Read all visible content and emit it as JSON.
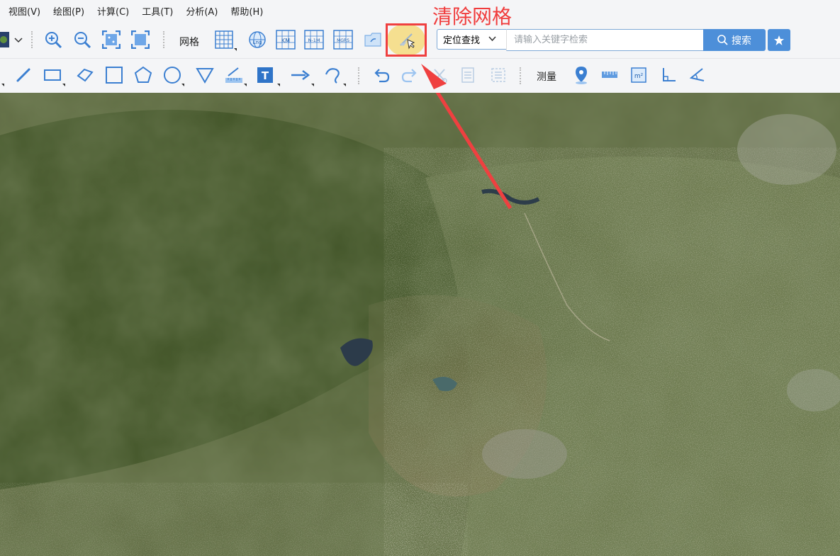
{
  "menu": {
    "items": [
      "视图(V)",
      "绘图(P)",
      "计算(C)",
      "工具(T)",
      "分析(A)",
      "帮助(H)"
    ]
  },
  "toolbar1": {
    "grid_label": "网格",
    "icons": {
      "latlng": "Lng",
      "km": "KM",
      "nm": "N-1M",
      "mgrs": "MGRS"
    }
  },
  "search": {
    "dropdown_value": "定位查找",
    "placeholder": "请输入关键字检索",
    "button_label": "搜索"
  },
  "toolbar2": {
    "measure_label": "测量",
    "text_tool": "T",
    "area_unit": "m²"
  },
  "annotation": {
    "title": "清除网格"
  },
  "colors": {
    "accent": "#4d8fd9",
    "annotation_red": "#ef4040"
  }
}
